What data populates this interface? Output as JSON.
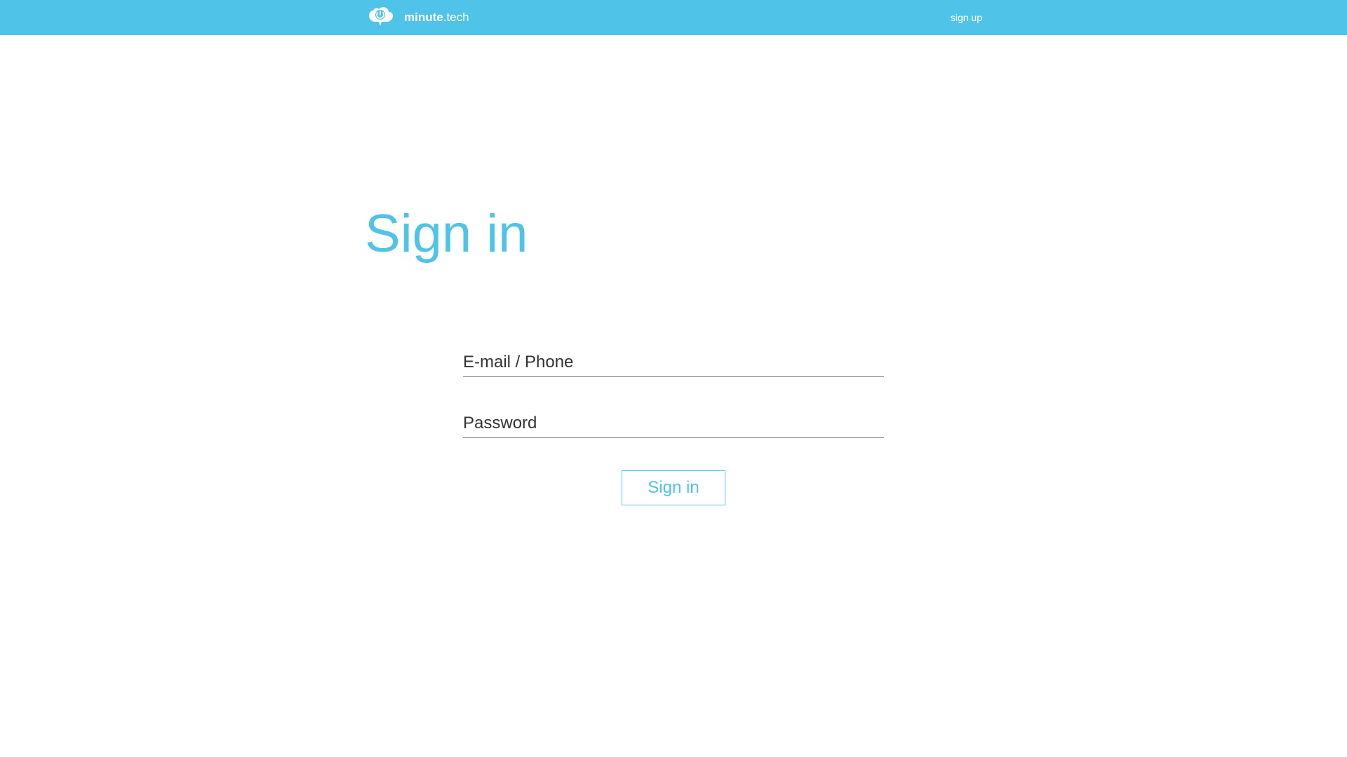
{
  "header": {
    "logo": {
      "text_bold": "minute",
      "text_light": ".tech"
    },
    "signup_link": "sign up"
  },
  "main": {
    "title": "Sign in",
    "form": {
      "email_placeholder": "E-mail / Phone",
      "password_placeholder": "Password",
      "submit_label": "Sign in"
    }
  },
  "colors": {
    "primary": "#4fc3e8",
    "text": "#333333"
  }
}
